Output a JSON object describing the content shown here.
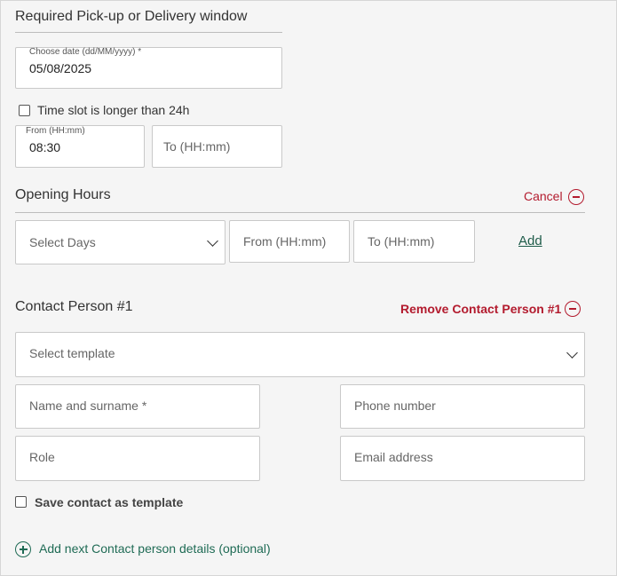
{
  "pickup": {
    "title": "Required Pick-up or Delivery window",
    "date_label": "Choose date (dd/MM/yyyy) *",
    "date_value": "05/08/2025",
    "longer_than_24h_label": "Time slot is longer than 24h",
    "from_label": "From (HH:mm)",
    "from_value": "08:30",
    "to_placeholder": "To (HH:mm)"
  },
  "opening_hours": {
    "title": "Opening Hours",
    "cancel_label": "Cancel",
    "select_days_placeholder": "Select Days",
    "from_placeholder": "From (HH:mm)",
    "to_placeholder": "To (HH:mm)",
    "add_label": "Add"
  },
  "contact": {
    "title": "Contact Person #1",
    "remove_label": "Remove Contact Person #1",
    "template_placeholder": "Select template",
    "name_placeholder": "Name and surname *",
    "phone_placeholder": "Phone number",
    "role_placeholder": "Role",
    "email_placeholder": "Email address",
    "save_template_label": "Save contact as template",
    "add_next_label": "Add next Contact person details (optional)"
  },
  "colors": {
    "accent_red": "#b31b2e",
    "accent_green": "#1f6b55"
  }
}
